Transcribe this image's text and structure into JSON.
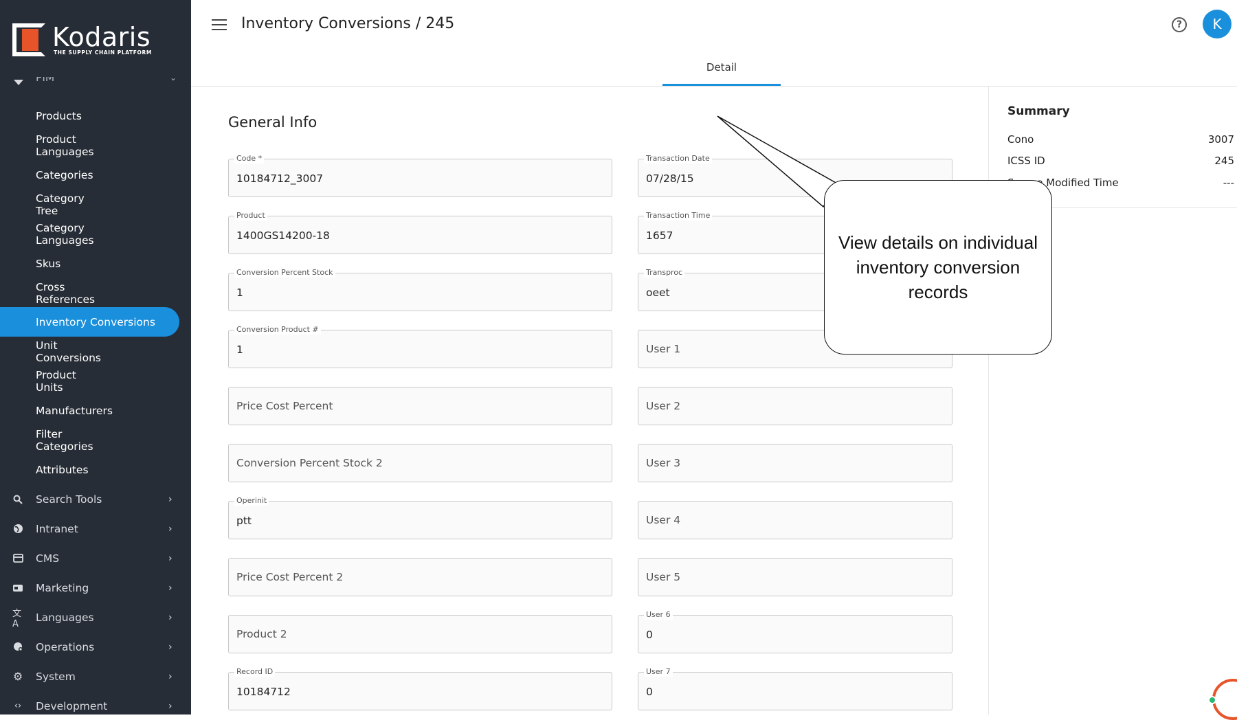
{
  "brand": {
    "name": "Kodaris",
    "tagline": "THE SUPPLY CHAIN PLATFORM"
  },
  "sidebar": {
    "section": "PIM",
    "items": [
      {
        "label": "Products"
      },
      {
        "label": "Product Languages"
      },
      {
        "label": "Categories"
      },
      {
        "label": "Category Tree"
      },
      {
        "label": "Category Languages"
      },
      {
        "label": "Skus"
      },
      {
        "label": "Cross References"
      },
      {
        "label": "Inventory Conversions",
        "active": true
      },
      {
        "label": "Unit Conversions"
      },
      {
        "label": "Product Units"
      },
      {
        "label": "Manufacturers"
      },
      {
        "label": "Filter Categories"
      },
      {
        "label": "Attributes"
      }
    ],
    "groups": [
      {
        "label": "Search Tools",
        "icon": "search-icon"
      },
      {
        "label": "Intranet",
        "icon": "globe-icon"
      },
      {
        "label": "CMS",
        "icon": "cms-icon"
      },
      {
        "label": "Marketing",
        "icon": "marketing-icon"
      },
      {
        "label": "Languages",
        "icon": "translate-icon"
      },
      {
        "label": "Operations",
        "icon": "operations-icon"
      },
      {
        "label": "System",
        "icon": "gear-icon"
      },
      {
        "label": "Development",
        "icon": "code-icon"
      }
    ]
  },
  "header": {
    "title": "Inventory Conversions / 245",
    "avatar_initial": "K",
    "tabs": [
      {
        "label": "Detail",
        "active": true
      }
    ]
  },
  "general_info": {
    "title": "General Info",
    "left": [
      {
        "label": "Code *",
        "value": "10184712_3007"
      },
      {
        "label": "Product",
        "value": "1400GS14200-18"
      },
      {
        "label": "Conversion Percent Stock",
        "value": "1"
      },
      {
        "label": "Conversion Product #",
        "value": "1"
      },
      {
        "label": "",
        "placeholder": "Price Cost Percent"
      },
      {
        "label": "",
        "placeholder": "Conversion Percent Stock 2"
      },
      {
        "label": "Operinit",
        "value": "ptt"
      },
      {
        "label": "",
        "placeholder": "Price Cost Percent 2"
      },
      {
        "label": "",
        "placeholder": "Product 2"
      },
      {
        "label": "Record ID",
        "value": "10184712"
      }
    ],
    "right": [
      {
        "label": "Transaction Date",
        "value": "07/28/15"
      },
      {
        "label": "Transaction Time",
        "value": "1657"
      },
      {
        "label": "Transproc",
        "value": "oeet"
      },
      {
        "label": "",
        "placeholder": "User 1"
      },
      {
        "label": "",
        "placeholder": "User 2"
      },
      {
        "label": "",
        "placeholder": "User 3"
      },
      {
        "label": "",
        "placeholder": "User 4"
      },
      {
        "label": "",
        "placeholder": "User 5"
      },
      {
        "label": "User 6",
        "value": "0"
      },
      {
        "label": "User 7",
        "value": "0"
      }
    ]
  },
  "summary": {
    "title": "Summary",
    "rows": [
      {
        "label": "Cono",
        "value": "3007"
      },
      {
        "label": "ICSS ID",
        "value": "245"
      },
      {
        "label": "Source Modified Time",
        "value": "---"
      }
    ]
  },
  "callout": {
    "text": "View details on individual inventory conversion records"
  },
  "colors": {
    "sidebar_bg": "#272d36",
    "accent": "#1a8fdc",
    "brand_orange": "#e8542a"
  }
}
